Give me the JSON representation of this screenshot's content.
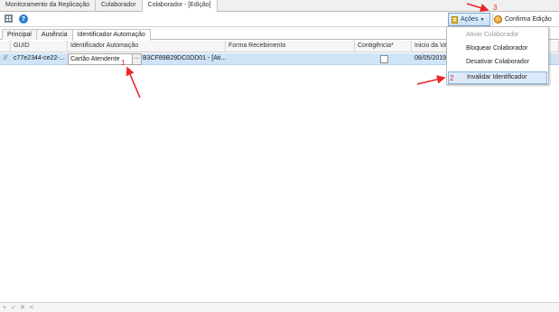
{
  "doc_tabs": [
    "Monitoramento da Replicação",
    "Colaborador",
    "Colaborador - [Edição]"
  ],
  "toolbar": {
    "help_icon": "help-icon",
    "grid_icon": "grid-icon",
    "acoes_label": "Ações",
    "confirma_label": "Confirma Edição"
  },
  "sub_tabs": [
    "Principal",
    "Ausência",
    "Identificador Automação"
  ],
  "grid": {
    "columns": [
      "GUID",
      "Identificador Automação",
      "Forma Recebimento",
      "Contigência*",
      "Inicio da Va"
    ],
    "row": {
      "indicator": "//",
      "guid": "c77e2344-ce22-...",
      "identificador": "Cartão Atendente",
      "identificador_btn": "...",
      "codigo": "B3CF89B29DC0DD01 - [Ati...",
      "contigencia": false,
      "inicio": "08/05/2019"
    }
  },
  "menu": {
    "items": [
      {
        "label": "Ativar Colaborador",
        "enabled": false
      },
      {
        "label": "Bloquear Colaborador",
        "enabled": true
      },
      {
        "label": "Desativar Colaborador",
        "enabled": true
      },
      {
        "label": "Invalidar Identificador",
        "enabled": true
      }
    ]
  },
  "annotations": {
    "n1": "1",
    "n2": "2",
    "n3": "3"
  },
  "statusbar": [
    "+",
    "✓",
    "✕",
    "<"
  ],
  "colors": {
    "annotation": "#e8262a",
    "row_selected": "#cfe4f7",
    "menu_highlight": "#dbe9f8"
  }
}
